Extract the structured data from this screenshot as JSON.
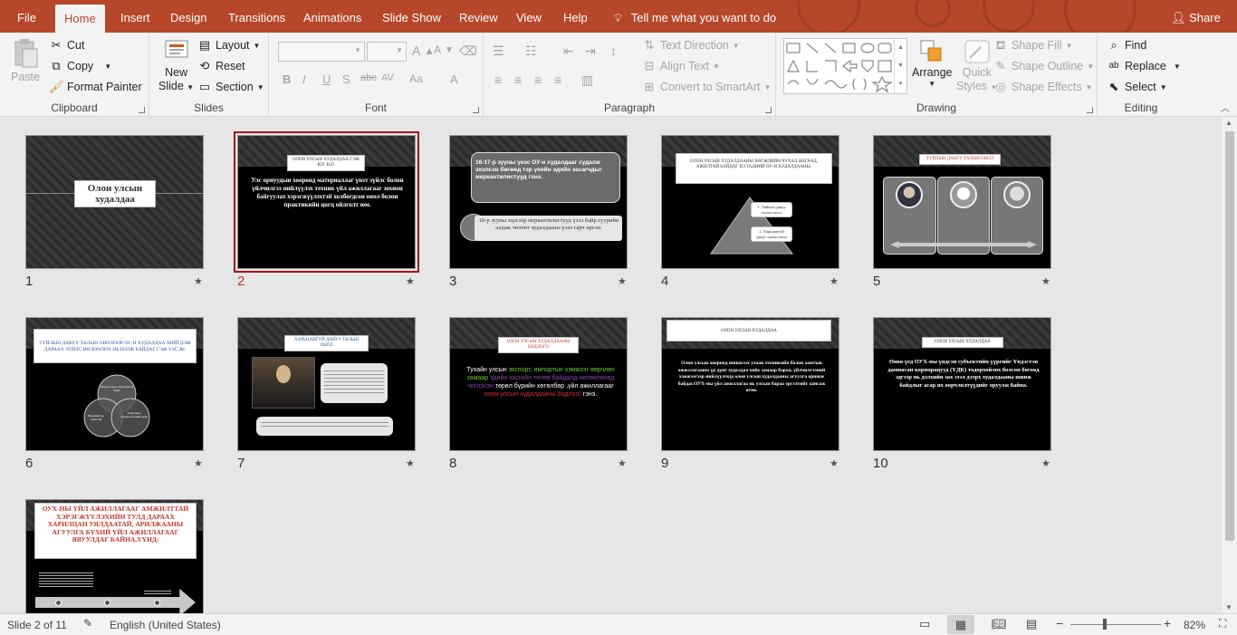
{
  "tabs": [
    "File",
    "Home",
    "Insert",
    "Design",
    "Transitions",
    "Animations",
    "Slide Show",
    "Review",
    "View",
    "Help"
  ],
  "tell_me": "Tell me what you want to do",
  "share": "Share",
  "clipboard": {
    "paste": "Paste",
    "cut": "Cut",
    "copy": "Copy",
    "format_painter": "Format Painter",
    "label": "Clipboard"
  },
  "slides_grp": {
    "new_slide": "New",
    "new_slide2": "Slide",
    "layout": "Layout",
    "reset": "Reset",
    "section": "Section",
    "label": "Slides"
  },
  "font_grp": {
    "label": "Font",
    "bold": "B",
    "italic": "I",
    "underline": "U",
    "shadow": "S",
    "strike": "abc",
    "spacing": "AV",
    "case": "Aa",
    "color": "A",
    "grow": "A",
    "shrink": "A"
  },
  "paragraph_grp": {
    "label": "Paragraph",
    "text_direction": "Text Direction",
    "align_text": "Align Text",
    "smartart": "Convert to SmartArt"
  },
  "drawing_grp": {
    "label": "Drawing",
    "arrange": "Arrange",
    "quick_styles": "Quick",
    "quick_styles2": "Styles",
    "shape_fill": "Shape Fill",
    "shape_outline": "Shape Outline",
    "shape_effects": "Shape Effects"
  },
  "editing_grp": {
    "label": "Editing",
    "find": "Find",
    "replace": "Replace",
    "select": "Select"
  },
  "slides": [
    {
      "num": "1",
      "title": "Олон улсын худалдаа"
    },
    {
      "num": "2",
      "title": "ОЛОН УЛСЫН ХУДАЛДАА ГЭЖ ЮУ ВЭ?",
      "body": "Улс орнуудын хооронд материаллаг үнэт зүйлс болон үйлчилгээ нийлүүлэх техник үйл ажиллагааг зохион байгуулах хэрэгжүүлэхтэй холбогдсон онол болон практикийн цогц ойлголт юм."
    },
    {
      "num": "3",
      "title": "16-17-р зууны үеэс ОУ-н худалдааг судалж эхэлсэн бөгөөд тэр үеийн эдийн засагчдыг меркантилистууд гэнэ.",
      "body": "18-р зууны эцэсээр меркантилистууд үзэл байр суурийн алдаж чөлөөт худалдааны үзэл гарч ирсэн."
    },
    {
      "num": "4",
      "title": "ОЛОН УЛСЫН ХУДАЛДААНЫ ХӨГЖЛИЙН ЧУХАЛ ЯАГААД, АЖИЛТАЙ БАЙДАГ ВЭ ГАДНИЙ ОУ-Н ХУДАЛДААНЫ.",
      "b1": "1. Тийшээ давуу талын онол",
      "b2": "2. Харьцангуй давуу талын онол"
    },
    {
      "num": "5",
      "title": "ТҮЙЛЫН ДАВУУ ТАЛЫН ОНОЛ"
    },
    {
      "num": "6",
      "title": "ТҮЙЛЫН ДАВУУ ТАЛЫН ОНОЛООР ОУ-Н ХУДАЛДАА ХИЙГДЭЖ ДАРААХ ЗҮЙЛС НӨЛӨӨЛӨХ НЬ БОЛЖ БАЙДАГ ГЭЖ ҮЗСЭН.",
      "c1": "Мэдлэгээрээ мэргэшсэн байх",
      "c2": "Нөөцийн үр ашигтай",
      "c3": "Хөдөлмөр үйлдвэрлэлийн хувь"
    },
    {
      "num": "7",
      "title": "ХАРЬЦАНГУЙ ДАВУУ ТАЛЫН ОНОЛ"
    },
    {
      "num": "8",
      "title": "ОЛОН УЛСЫН ХУДАЛДААНЫ БОДЛОГО"
    },
    {
      "num": "9",
      "title": "ОЛОН УЛСЫН ХУДАЛДАА",
      "body": "Олон улсын хооронд шинжлэх ухаан техникийн болон хамтын ажиллагааны үр дүнг худалдаа хийх замаар бараа, үйлчилгээний хэмжээгээр нийлүүлэхэд олон улсын худалдааны агуулга оршиж байдаг.ОУХ-ны үйл ажиллагаа нь улсын бараа эргэлтийг хангаж өгнө."
    },
    {
      "num": "10",
      "title": "ОЛОН УЛСЫН ХУДАЛДАА",
      "body": "Өнөө үед ОУХ-ны үндсэн субъектийн үүргийг Үндэстэн дамнасан корпорацууд (ҮДК) тодорхойлох болсон бөгөөд эдгээр нь дэлхийн зах зээл дээрх худалдааны шинж байдлыг асар их өөрчлөлтүүдийг оруулж байна."
    },
    {
      "num": "11",
      "title": "ОУХ-НЫ ҮЙЛ АЖИЛЛАГААГ АМЖИЛТТАЙ ХЭРЭГЖҮҮЛЭХИЙН ТУЛД ДАРААХ ХАРИЛЦАН УЯЛДААТАЙ, АРИЛЖААНЫ АГУУЛГА БҮХИЙ ҮЙЛ АЖИЛЛАГААГ ЯВУУЛДАГ БАЙНА.ҮҮНД:"
    }
  ],
  "slide8_parts": [
    {
      "t": "Тухайн улсын ",
      "c": "#ffffff"
    },
    {
      "t": "экспорт, импортын хэмжээг өөрчлөх замаар ",
      "c": "#66cc33"
    },
    {
      "t": "эдийн засгийн төлөв байдалд нөлөөлөхөд чиглэсэн ",
      "c": "#8e44ad"
    },
    {
      "t": "төрөл бүрийн хөтөлбөр ,үйл ажиллагааг ",
      "c": "#ffffff"
    },
    {
      "t": "олон улсын худалдааны бодлого ",
      "c": "#e03030"
    },
    {
      "t": "гэнэ.",
      "c": "#ffffff"
    }
  ],
  "status": {
    "slide_info": "Slide 2 of 11",
    "language": "English (United States)",
    "zoom": "82%"
  }
}
